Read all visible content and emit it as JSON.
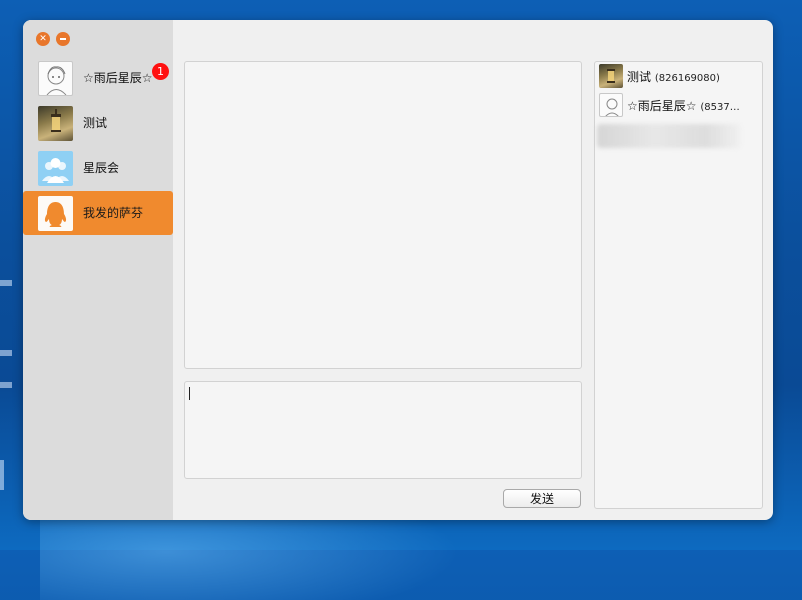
{
  "window": {
    "controls": {
      "close_icon": "close-icon",
      "minimize_icon": "minimize-icon"
    }
  },
  "sidebar": {
    "contacts": [
      {
        "name": "☆雨后星辰☆",
        "avatar": "sketch-character-avatar",
        "unread": "1"
      },
      {
        "name": "测试",
        "avatar": "lantern-photo-avatar"
      },
      {
        "name": "星辰会",
        "avatar": "group-avatar"
      },
      {
        "name": "我发的萨芬",
        "avatar": "qq-penguin-avatar",
        "active": true
      }
    ]
  },
  "chat": {
    "send_label": "发送",
    "input_value": ""
  },
  "members": [
    {
      "name": "测试",
      "id": "(826169080)",
      "avatar": "lantern-photo-avatar"
    },
    {
      "name": "☆雨后星辰☆",
      "id": "(8537…",
      "avatar": "sketch-character-avatar"
    }
  ],
  "colors": {
    "accent": "#f08a2e",
    "badge": "#ff1010",
    "sidebar_bg": "#dcdcdc",
    "panel_bg": "#f5f5f5"
  }
}
